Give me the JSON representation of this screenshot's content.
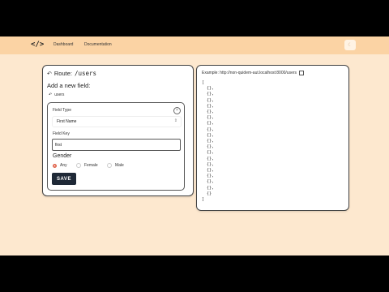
{
  "nav": {
    "logo": "</>",
    "links": [
      "Dashboard",
      "Documentation"
    ],
    "theme_icon": "moon-icon"
  },
  "form_card": {
    "route_label": "Route:",
    "route_path": "/users",
    "heading": "Add a new field:",
    "back_link": "users",
    "field": {
      "type_label": "Field Type",
      "type_value": "First Name",
      "key_label": "Field Key",
      "key_value": "first",
      "gender_label": "Gender",
      "gender_options": [
        "Any",
        "Female",
        "Male"
      ],
      "gender_selected": "Any"
    },
    "save_label": "SAVE"
  },
  "example_card": {
    "label": "Example: http://non-quidem-aut.localhost:8000/users",
    "json_open": "[",
    "json_items": [
      "{},",
      "{},",
      "{},",
      "{},",
      "{},",
      "{},",
      "{},",
      "{},",
      "{},",
      "{},",
      "{},",
      "{},",
      "{},",
      "{},",
      "{},",
      "{},",
      "{},",
      "{},",
      "{}"
    ],
    "json_close": "]"
  }
}
